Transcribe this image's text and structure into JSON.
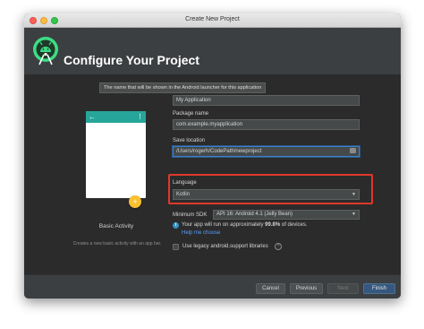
{
  "window": {
    "title": "Create New Project"
  },
  "header": {
    "title": "Configure Your Project",
    "logo_icon": "android-studio-icon"
  },
  "tooltip": "The name that will be shown in the Android launcher for this application",
  "preview": {
    "activity_name": "Basic Activity",
    "activity_description": "Creates a new basic activity with an app bar.",
    "appbar_color": "#26a69a",
    "fab_color": "#fbc02d"
  },
  "form": {
    "name_value": "My Application",
    "package_label": "Package name",
    "package_value": "com.example.myapplication",
    "location_label": "Save location",
    "location_value": "/Users/rogerh/CodePath/newproject",
    "language_label": "Language",
    "language_value": "Kotlin",
    "sdk_label": "Minimum SDK",
    "sdk_value": "API 16: Android 4.1 (Jelly Bean)",
    "info_prefix": "Your app will run on approximately ",
    "info_percent": "99.8%",
    "info_suffix": " of devices.",
    "help_link": "Help me choose",
    "legacy_label": "Use legacy android.support libraries",
    "legacy_checked": false
  },
  "footer": {
    "cancel": "Cancel",
    "previous": "Previous",
    "next": "Next",
    "finish": "Finish"
  },
  "colors": {
    "highlight": "#e0382b",
    "primary_button": "#365880",
    "link": "#589df6"
  }
}
